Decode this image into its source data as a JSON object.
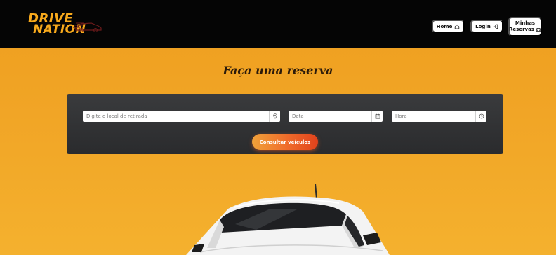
{
  "header": {
    "logo": {
      "line1": "DRIVE",
      "line2": "NATION"
    },
    "nav": {
      "home_label": "Home",
      "login_label": "Login",
      "reservas_line1": "Minhas",
      "reservas_line2": "Reservas"
    }
  },
  "main": {
    "title": "Faça uma reserva",
    "search": {
      "location_placeholder": "Digite o local de retirada",
      "date_placeholder": "Data",
      "time_placeholder": "Hora",
      "submit_label": "Consultar veículos"
    }
  },
  "colors": {
    "brand_orange": "#f7a91c",
    "page_bg": "#f1a526",
    "header_bg": "#050505",
    "card_bg": "#333436",
    "button_gradient": [
      "#f1a23a",
      "#e1421c"
    ]
  },
  "icons": {
    "home": "home-icon",
    "login": "login-icon",
    "reservas": "car-icon",
    "location": "location-pin-icon",
    "date": "calendar-icon",
    "time": "clock-icon"
  }
}
